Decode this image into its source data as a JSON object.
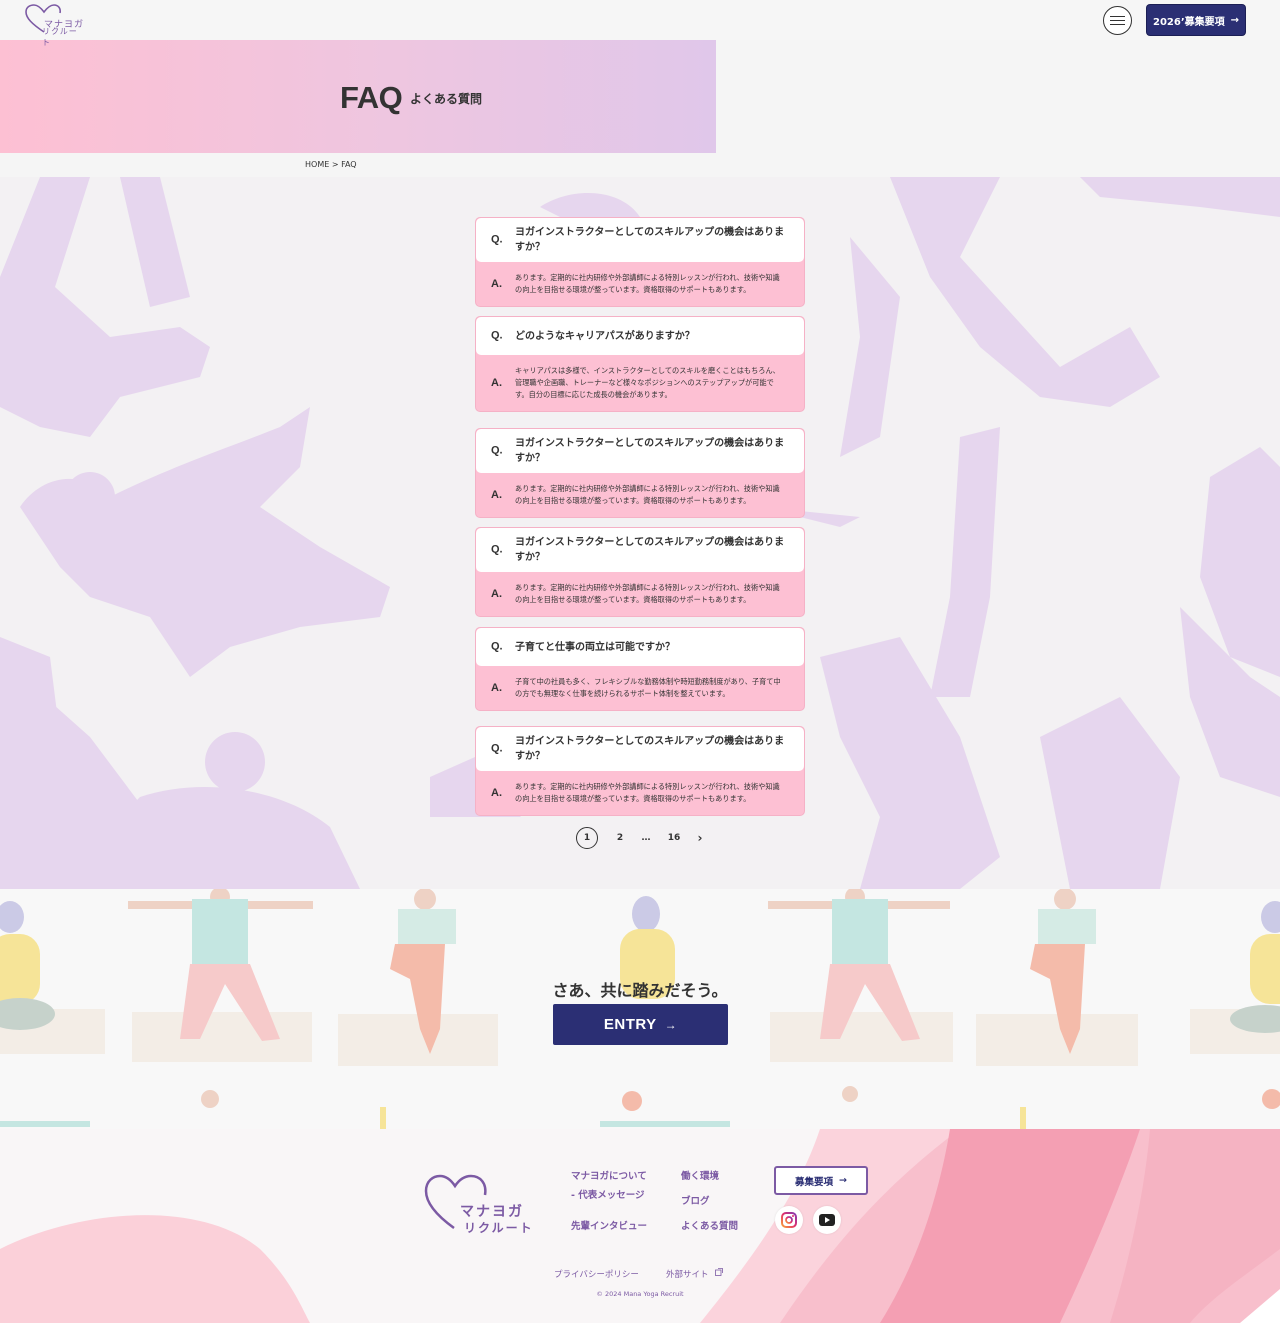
{
  "header": {
    "logo_line1": "マナヨガ",
    "logo_line2": "リクルート",
    "recruit_button": "2026’募集要項"
  },
  "hero": {
    "title": "FAQ",
    "subtitle": "よくある質問"
  },
  "breadcrumb": {
    "home": "HOME",
    "separator": ">",
    "current": "FAQ"
  },
  "faq": {
    "q_mark": "Q.",
    "a_mark": "A.",
    "items": [
      {
        "question": "ヨガインストラクターとしてのスキルアップの機会はありますか？",
        "answer": "あります。定期的に社内研修や外部講師による特別レッスンが行われ、技術や知識の向上を目指せる環境が整っています。資格取得のサポートもあります。"
      },
      {
        "question": "どのようなキャリアパスがありますか？",
        "answer": "キャリアパスは多様で、インストラクターとしてのスキルを磨くことはもちろん、管理職や企画職、トレーナーなど様々なポジションへのステップアップが可能です。自分の目標に応じた成長の機会があります。"
      },
      {
        "question": "ヨガインストラクターとしてのスキルアップの機会はありますか？",
        "answer": "あります。定期的に社内研修や外部講師による特別レッスンが行われ、技術や知識の向上を目指せる環境が整っています。資格取得のサポートもあります。"
      },
      {
        "question": "ヨガインストラクターとしてのスキルアップの機会はありますか？",
        "answer": "あります。定期的に社内研修や外部講師による特別レッスンが行われ、技術や知識の向上を目指せる環境が整っています。資格取得のサポートもあります。"
      },
      {
        "question": "子育てと仕事の両立は可能ですか？",
        "answer": "子育て中の社員も多く、フレキシブルな勤務体制や時短勤務制度があり、子育て中の方でも無理なく仕事を続けられるサポート体制を整えています。"
      },
      {
        "question": "ヨガインストラクターとしてのスキルアップの機会はありますか？",
        "answer": "あります。定期的に社内研修や外部講師による特別レッスンが行われ、技術や知識の向上を目指せる環境が整っています。資格取得のサポートもあります。"
      }
    ]
  },
  "pagination": {
    "current": "1",
    "page2": "2",
    "ellipsis": "…",
    "last": "16",
    "next": "›"
  },
  "entry": {
    "title": "さあ、共に踏みだそう。",
    "button": "ENTRY"
  },
  "footer": {
    "logo_line1": "マナヨガ",
    "logo_line2": "リクルート",
    "nav": {
      "about": "マナヨガについて",
      "message": "- 代表メッセージ",
      "interview": "先輩インタビュー",
      "environment": "働く環境",
      "blog": "ブログ",
      "faq": "よくある質問"
    },
    "recruit_button": "募集要項",
    "privacy": "プライバシーポリシー",
    "external": "外部サイト",
    "copyright": "© 2024 Mana Yoga Recruit"
  },
  "colors": {
    "navy": "#2b2f74",
    "pink": "#fdc0d3",
    "lavender": "#e0c7ea",
    "purple": "#7c5aa4"
  },
  "icons": [
    "heart-logo-icon",
    "menu-icon",
    "arrow-right-icon",
    "instagram-icon",
    "youtube-icon",
    "external-link-icon"
  ]
}
